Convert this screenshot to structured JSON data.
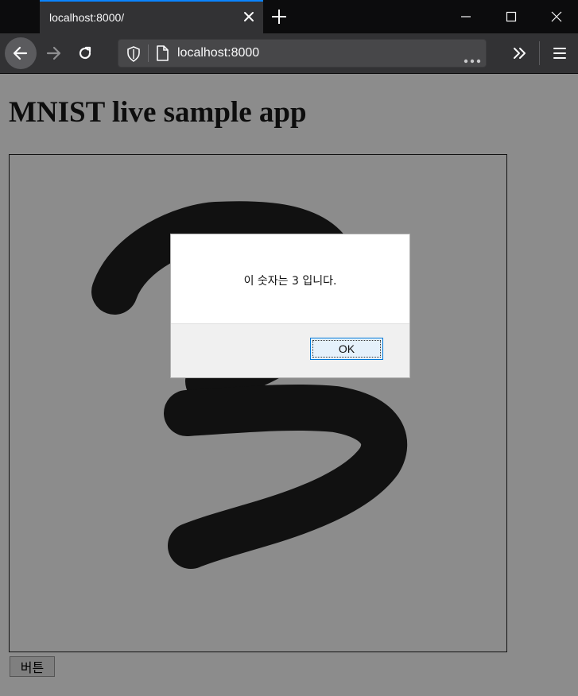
{
  "browser": {
    "tab_title": "localhost:8000/",
    "url": "localhost:8000"
  },
  "page": {
    "title": "MNIST live sample app",
    "button_label": "버튼"
  },
  "dialog": {
    "message": "이 숫자는 3 입니다.",
    "ok_label": "OK"
  },
  "colors": {
    "page_background": "#8c8c8c",
    "stroke": "#111111",
    "accent": "#0a84ff"
  }
}
